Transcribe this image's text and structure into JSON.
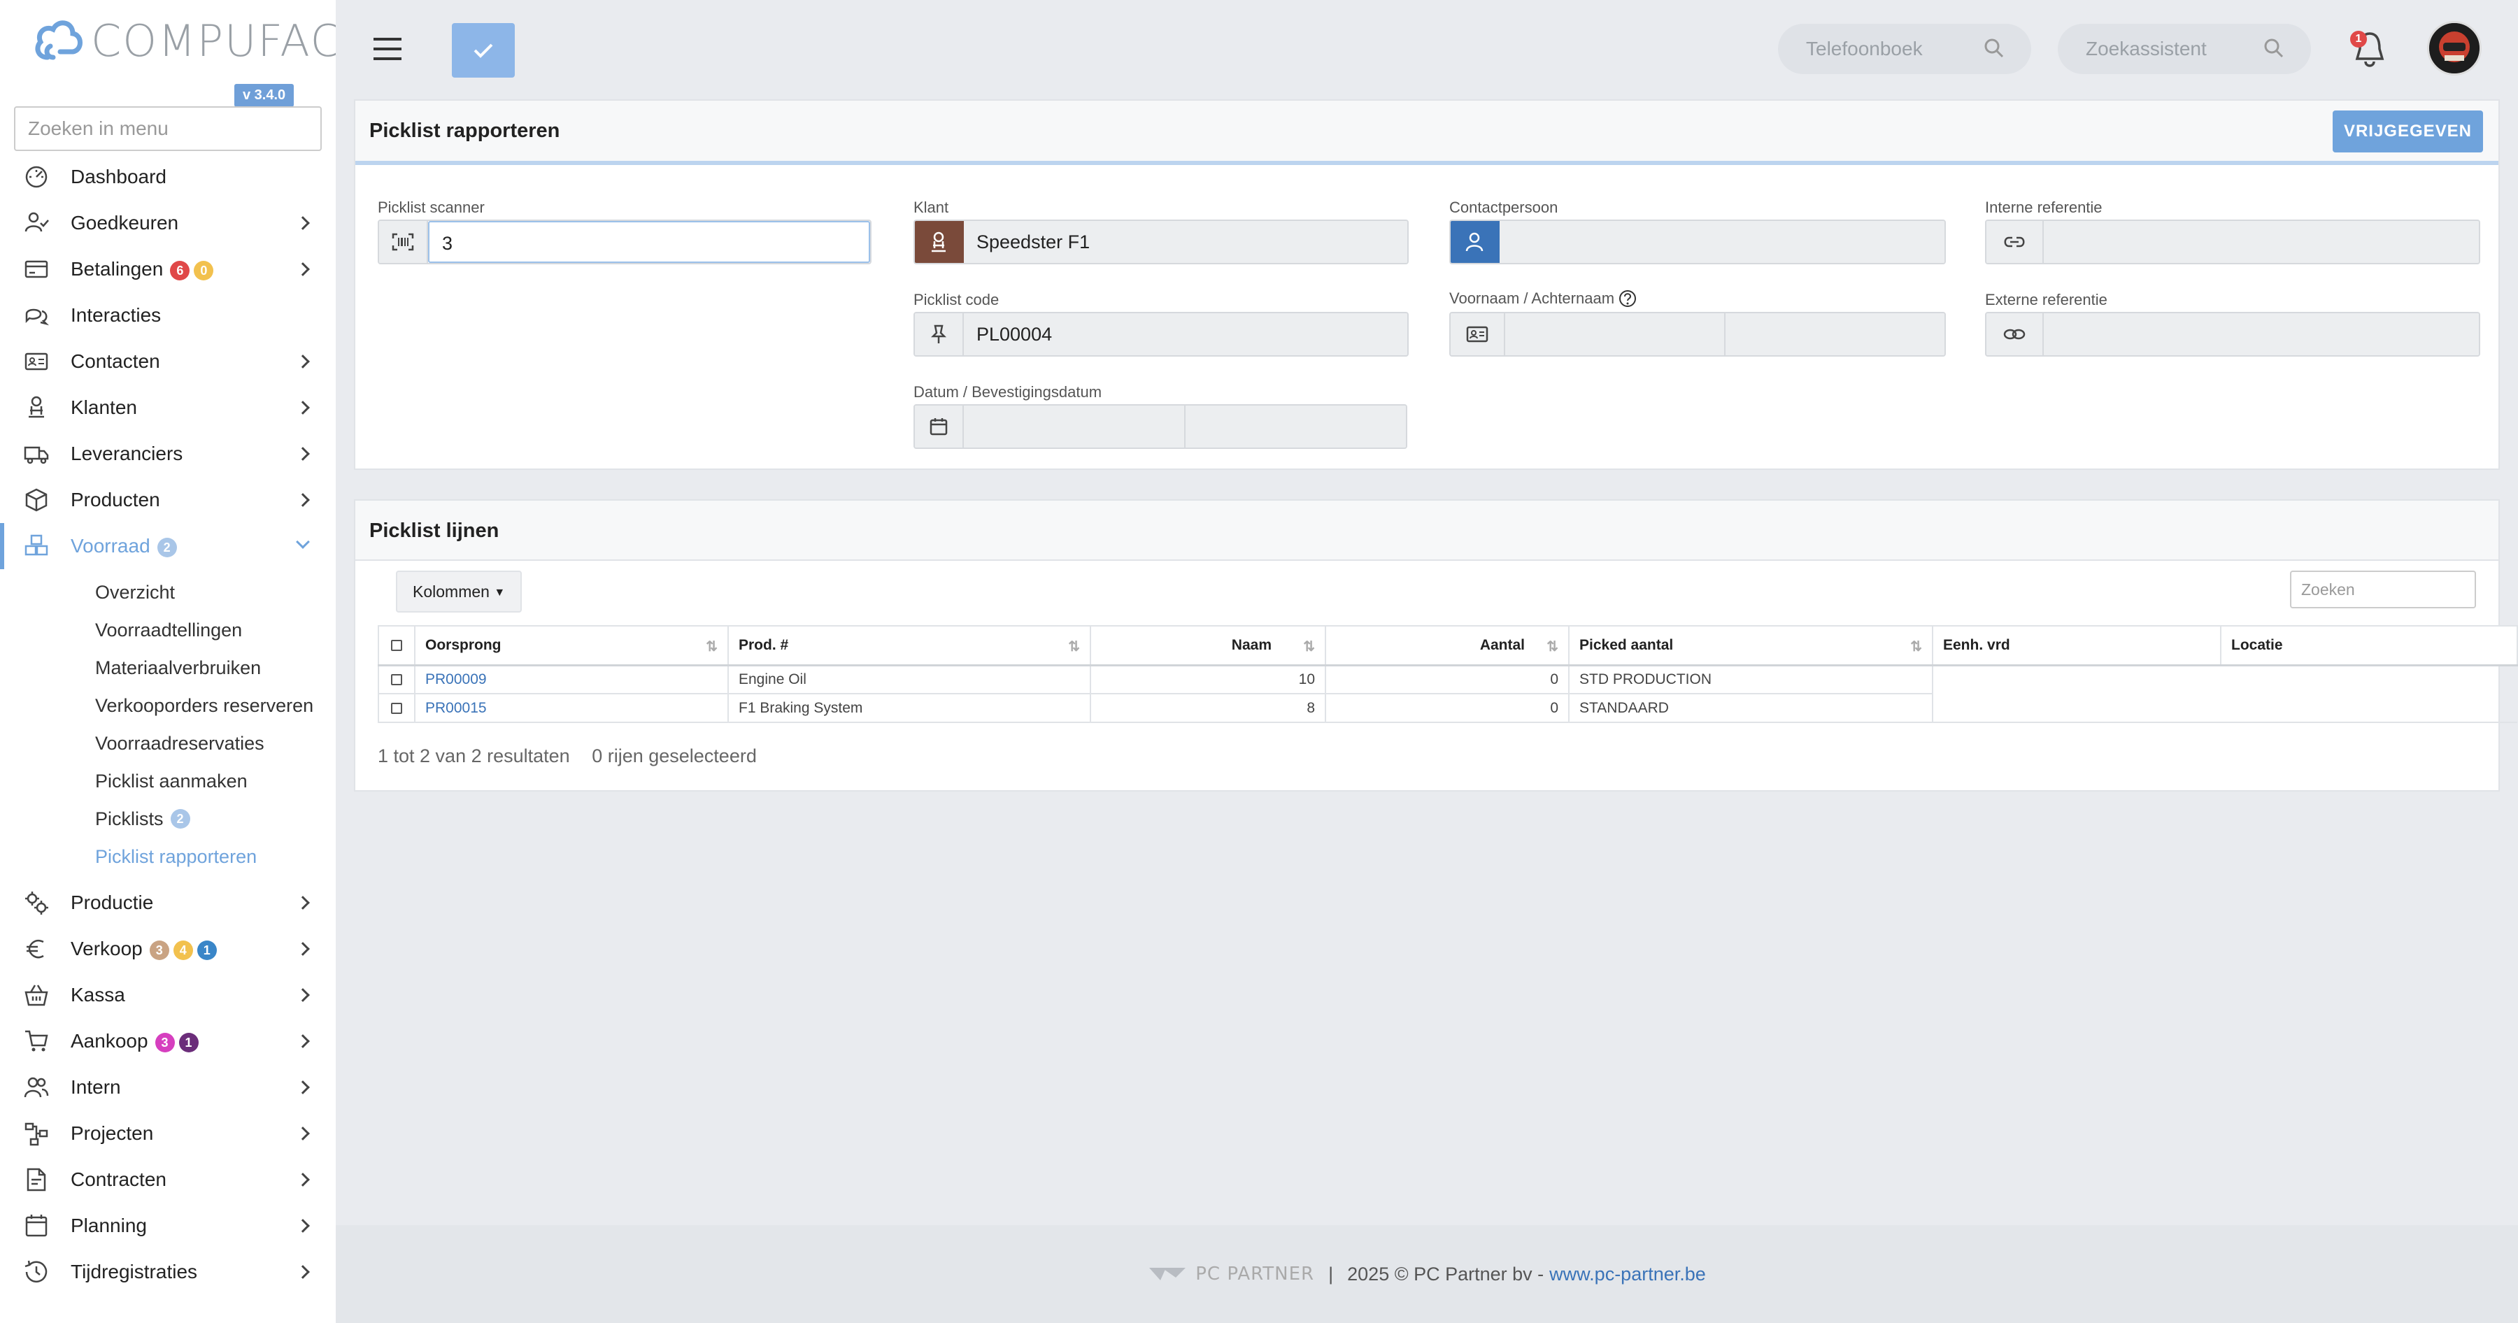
{
  "app": {
    "name": "COMPUFACT",
    "version": "v 3.4.0"
  },
  "menu_search_placeholder": "Zoeken in menu",
  "nav": [
    {
      "label": "Dashboard",
      "icon": "dashboard-icon",
      "chevron": false
    },
    {
      "label": "Goedkeuren",
      "icon": "user-check-icon",
      "chevron": true
    },
    {
      "label": "Betalingen",
      "icon": "credit-card-icon",
      "chevron": true,
      "badges": [
        {
          "text": "6",
          "color": "#e04848"
        },
        {
          "text": "0",
          "color": "#f2c14e"
        }
      ]
    },
    {
      "label": "Interacties",
      "icon": "chat-icon",
      "chevron": false
    },
    {
      "label": "Contacten",
      "icon": "id-card-icon",
      "chevron": true
    },
    {
      "label": "Klanten",
      "icon": "customer-icon",
      "chevron": true
    },
    {
      "label": "Leveranciers",
      "icon": "truck-icon",
      "chevron": true
    },
    {
      "label": "Producten",
      "icon": "box-icon",
      "chevron": true
    },
    {
      "label": "Voorraad",
      "icon": "boxes-icon",
      "chevron": true,
      "active": true,
      "badges": [
        {
          "text": "2",
          "color": "#a9c6e8"
        }
      ]
    }
  ],
  "subnav": [
    {
      "label": "Overzicht"
    },
    {
      "label": "Voorraadtellingen"
    },
    {
      "label": "Materiaalverbruiken"
    },
    {
      "label": "Verkooporders reserveren"
    },
    {
      "label": "Voorraadreservaties"
    },
    {
      "label": "Picklist aanmaken"
    },
    {
      "label": "Picklists",
      "badge": {
        "text": "2",
        "color": "#a9c6e8"
      }
    },
    {
      "label": "Picklist rapporteren",
      "active": true
    }
  ],
  "nav2": [
    {
      "label": "Productie",
      "icon": "gears-icon",
      "chevron": true
    },
    {
      "label": "Verkoop",
      "icon": "euro-icon",
      "chevron": true,
      "badges": [
        {
          "text": "3",
          "color": "#c9a383"
        },
        {
          "text": "4",
          "color": "#f2c14e"
        },
        {
          "text": "1",
          "color": "#3a86c8"
        }
      ]
    },
    {
      "label": "Kassa",
      "icon": "basket-icon",
      "chevron": true
    },
    {
      "label": "Aankoop",
      "icon": "cart-icon",
      "chevron": true,
      "badges": [
        {
          "text": "3",
          "color": "#d63fbf"
        },
        {
          "text": "1",
          "color": "#6b2d7a"
        }
      ]
    },
    {
      "label": "Intern",
      "icon": "users-icon",
      "chevron": true
    },
    {
      "label": "Projecten",
      "icon": "project-icon",
      "chevron": true
    },
    {
      "label": "Contracten",
      "icon": "contract-icon",
      "chevron": true
    },
    {
      "label": "Planning",
      "icon": "calendar-icon",
      "chevron": true
    },
    {
      "label": "Tijdregistraties",
      "icon": "clock-icon",
      "chevron": true
    }
  ],
  "topbar": {
    "phonebook_placeholder": "Telefoonboek",
    "assistant_placeholder": "Zoekassistent",
    "notification_count": "1"
  },
  "report": {
    "title": "Picklist rapporteren",
    "release_label": "VRIJGEGEVEN",
    "scanner_label": "Picklist scanner",
    "scanner_value": "3",
    "customer_label": "Klant",
    "customer_value": "Speedster F1",
    "picklist_code_label": "Picklist code",
    "picklist_code_value": "PL00004",
    "date_label": "Datum / Bevestigingsdatum",
    "contact_label": "Contactpersoon",
    "name_label": "Voornaam / Achternaam",
    "internal_ref_label": "Interne referentie",
    "external_ref_label": "Externe referentie"
  },
  "lines": {
    "title": "Picklist lijnen",
    "columns_button": "Kolommen",
    "search_placeholder": "Zoeken",
    "headers": [
      "Oorsprong",
      "Prod. #",
      "Naam",
      "Aantal",
      "Picked aantal",
      "Eenh. vrd",
      "Locatie"
    ],
    "rows": [
      {
        "origin": "PR00009",
        "product": "Engine Oil",
        "name": "10",
        "qty": "0",
        "picked": "STD PRODUCTION"
      },
      {
        "origin": "PR00015",
        "product": "F1 Braking System",
        "name": "8",
        "qty": "0",
        "picked": "STANDAARD"
      }
    ],
    "summary": "1 tot 2 van 2 resultaten",
    "selected": "0 rijen geselecteerd"
  },
  "footer": {
    "brand": "PC PARTNER",
    "separator": "|",
    "copyright": "2025 © PC Partner bv -",
    "link": "www.pc-partner.be"
  }
}
